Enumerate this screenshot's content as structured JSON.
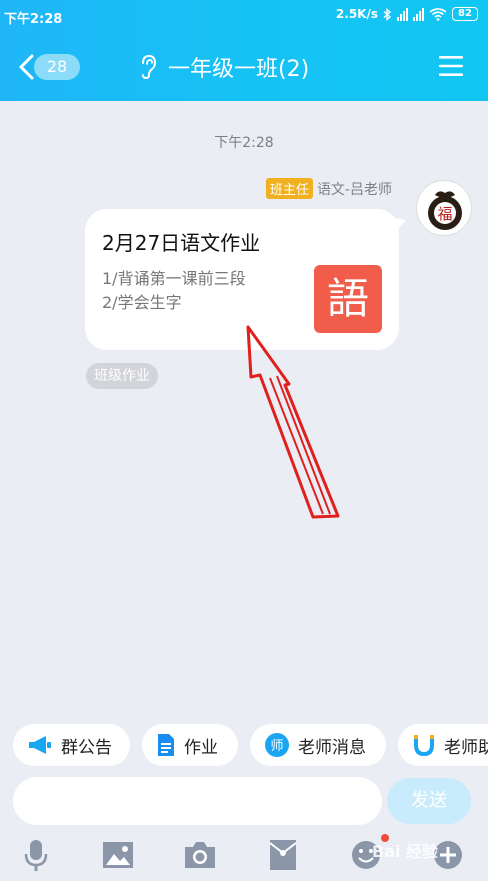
{
  "status_bar": {
    "time": "下午2:28",
    "speed": "2.5K/s",
    "battery": "82"
  },
  "nav": {
    "back_badge": "28",
    "title": "一年级一班(2)"
  },
  "chat": {
    "timestamp": "下午2:28",
    "sender_role": "班主任",
    "sender_name": "语文-吕老师",
    "avatar_char": "福",
    "homework": {
      "title": "2月27日语文作业",
      "line1": "1/背诵第一课前三段",
      "line2": "2/学会生字",
      "subject_char": "語"
    },
    "tag": "班级作业"
  },
  "chips": [
    {
      "label": "群公告",
      "icon": "megaphone-icon"
    },
    {
      "label": "作业",
      "icon": "document-icon"
    },
    {
      "label": "老师消息",
      "icon": "teacher-icon"
    },
    {
      "label": "老师助",
      "icon": "u-magnet-icon"
    }
  ],
  "input": {
    "placeholder": "",
    "send_label": "发送"
  },
  "toolbar": [
    "mic-icon",
    "image-icon",
    "camera-icon",
    "red-packet-icon",
    "emoji-icon",
    "plus-icon"
  ],
  "watermark": "Bai 经验",
  "colors": {
    "header": "#1fb6f7",
    "chat_bg": "#ebedf5",
    "role_badge": "#f0b020",
    "subject_icon": "#f25c4a",
    "arrow": "#e0201c",
    "send_btn": "#c8ecfb"
  }
}
